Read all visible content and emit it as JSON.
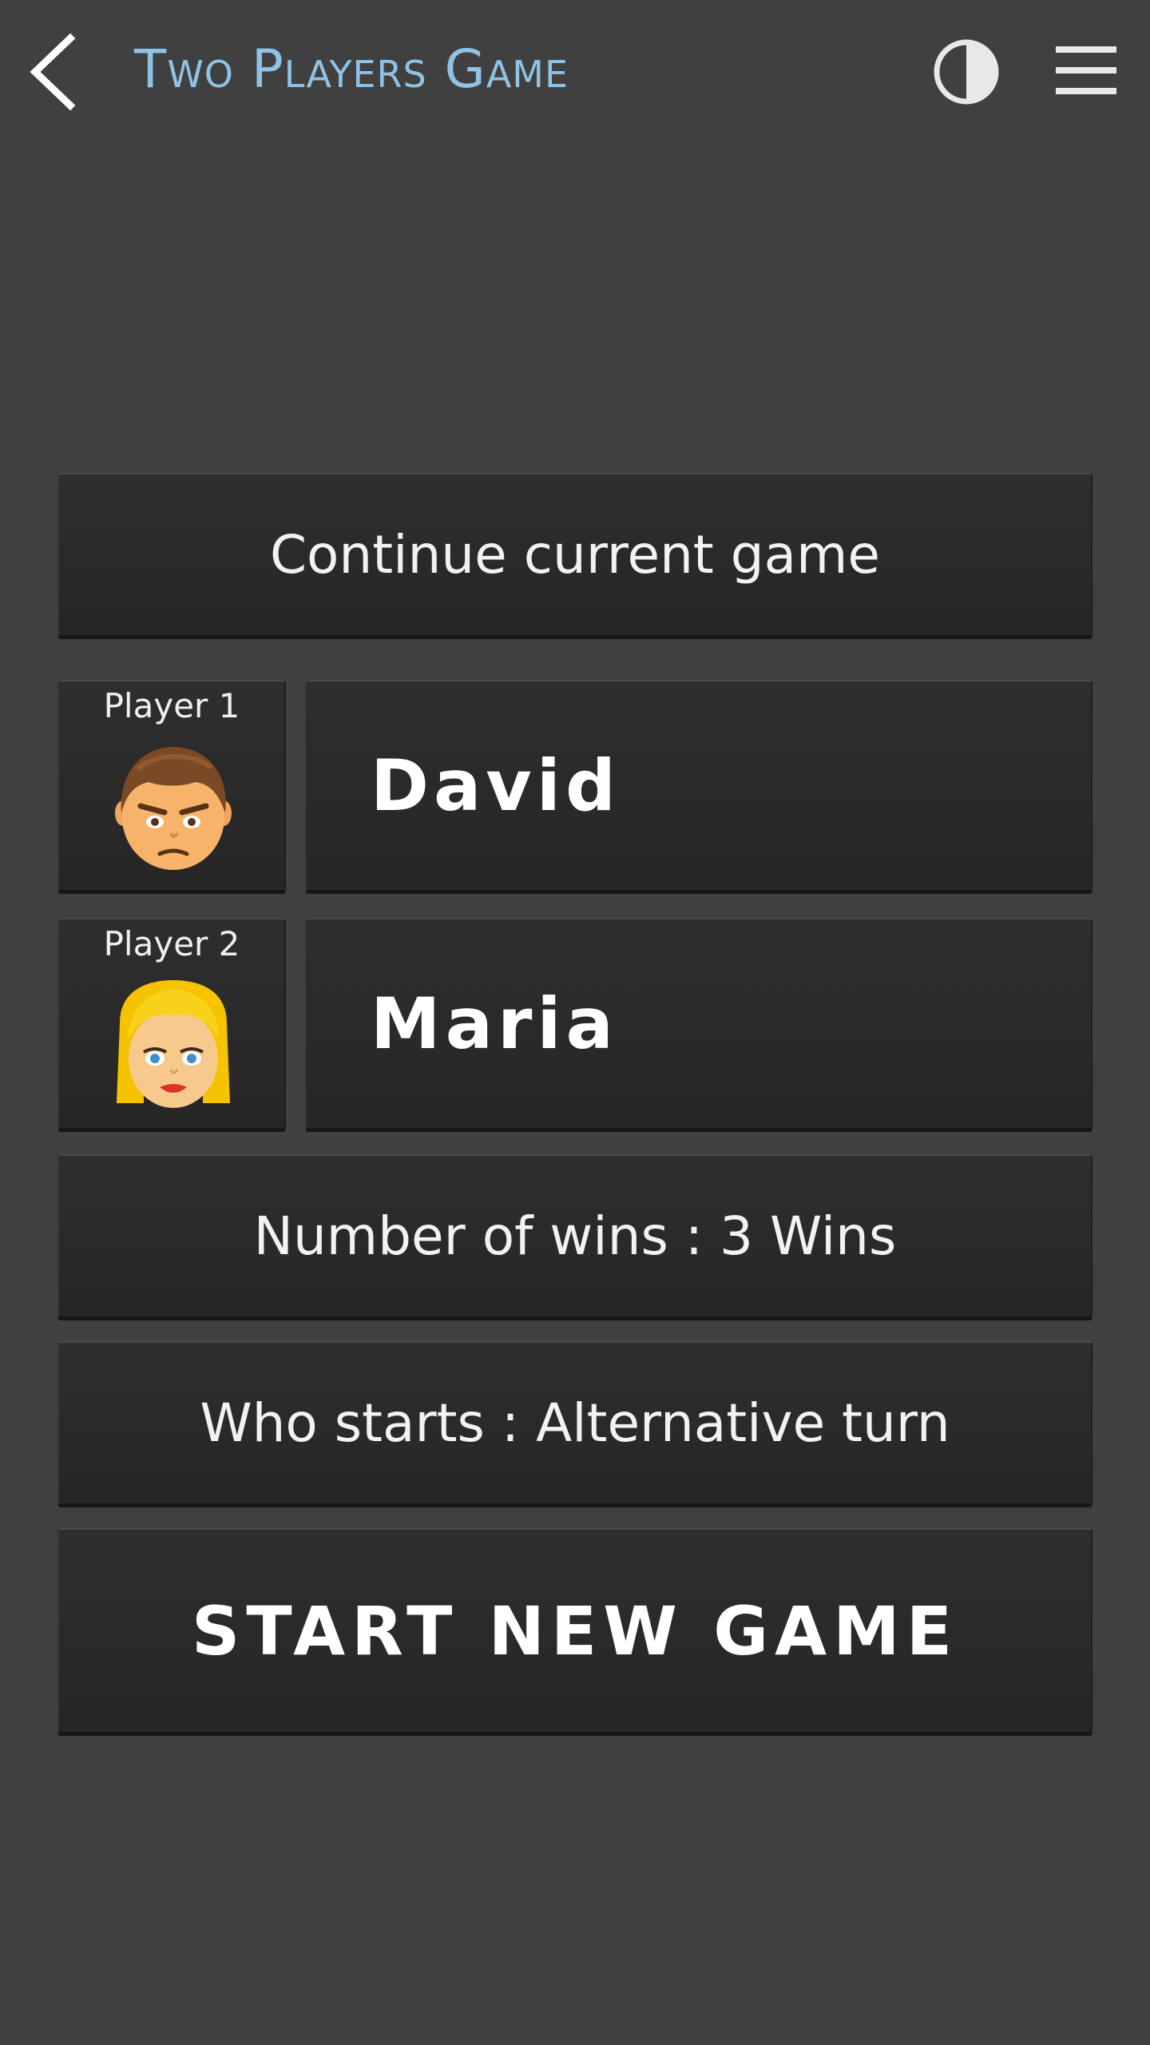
{
  "header": {
    "title": "Two Players Game",
    "back_icon": "chevron-left-icon",
    "contrast_icon": "contrast-icon",
    "menu_icon": "hamburger-menu-icon",
    "title_color": "#8fc3e6"
  },
  "main": {
    "continue_label": "Continue current game",
    "players": [
      {
        "label": "Player 1",
        "name": "David",
        "avatar": "boy-face-icon"
      },
      {
        "label": "Player 2",
        "name": "Maria",
        "avatar": "girl-face-icon"
      }
    ],
    "wins_label": "Number of wins : 3 Wins",
    "who_starts_label": "Who starts : Alternative turn",
    "start_label": "START NEW GAME"
  },
  "colors": {
    "background": "#404040",
    "panel": "#2a2a2a"
  }
}
